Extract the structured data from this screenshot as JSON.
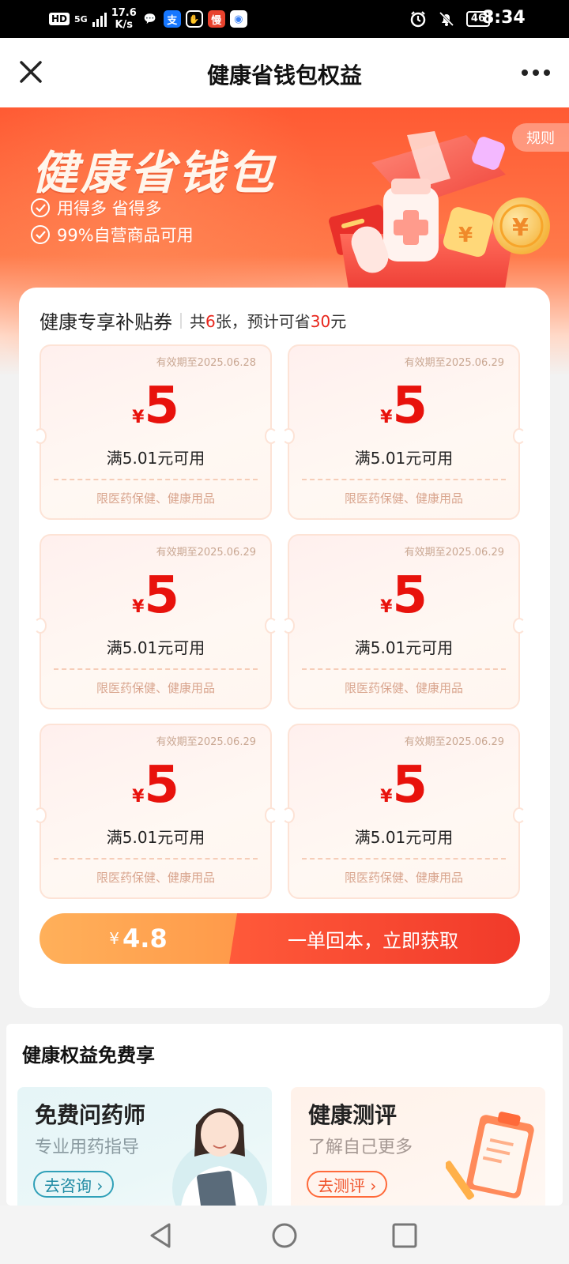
{
  "status_bar": {
    "hd": "HD",
    "network": "5G",
    "speed_value": "17.6",
    "speed_unit": "K/s",
    "battery": "46",
    "time": "8:34",
    "apps": [
      {
        "name": "wechat-icon",
        "glyph": "💬",
        "color": "#ffffff"
      },
      {
        "name": "alipay-icon",
        "glyph": "支",
        "color": "#1677ff"
      },
      {
        "name": "hand-icon",
        "glyph": "✋",
        "color": "#ffffff"
      },
      {
        "name": "man-icon",
        "glyph": "慢",
        "color": "#e8422d"
      },
      {
        "name": "browser-icon",
        "glyph": "◉",
        "color": "#3b82f6"
      }
    ]
  },
  "header": {
    "title": "健康省钱包权益"
  },
  "banner": {
    "title": "健康省钱包",
    "features": [
      "用得多 省得多",
      "99%自营商品可用"
    ],
    "rules_label": "规则"
  },
  "coupon_section": {
    "title": "健康专享补贴券",
    "summary_prefix": "共",
    "count": "6",
    "summary_mid": "张，预计可省",
    "saving": "30",
    "summary_suffix": "元",
    "coupons": [
      {
        "valid": "有效期至2025.06.28",
        "currency": "¥",
        "amount": "5",
        "condition": "满5.01元可用",
        "scope": "限医药保健、健康用品"
      },
      {
        "valid": "有效期至2025.06.29",
        "currency": "¥",
        "amount": "5",
        "condition": "满5.01元可用",
        "scope": "限医药保健、健康用品"
      },
      {
        "valid": "有效期至2025.06.29",
        "currency": "¥",
        "amount": "5",
        "condition": "满5.01元可用",
        "scope": "限医药保健、健康用品"
      },
      {
        "valid": "有效期至2025.06.29",
        "currency": "¥",
        "amount": "5",
        "condition": "满5.01元可用",
        "scope": "限医药保健、健康用品"
      },
      {
        "valid": "有效期至2025.06.29",
        "currency": "¥",
        "amount": "5",
        "condition": "满5.01元可用",
        "scope": "限医药保健、健康用品"
      },
      {
        "valid": "有效期至2025.06.29",
        "currency": "¥",
        "amount": "5",
        "condition": "满5.01元可用",
        "scope": "限医药保健、健康用品"
      }
    ],
    "cta": {
      "currency": "¥",
      "price": "4.8",
      "label": "一单回本，立即获取"
    }
  },
  "benefits": {
    "title": "健康权益免费享",
    "cards": [
      {
        "title": "免费问药师",
        "subtitle": "专业用药指导",
        "button": "去咨询 ›"
      },
      {
        "title": "健康测评",
        "subtitle": "了解自己更多",
        "button": "去测评 ›"
      }
    ]
  },
  "colors": {
    "accent_red": "#e8261c",
    "banner_orange": "#ff5a33"
  }
}
